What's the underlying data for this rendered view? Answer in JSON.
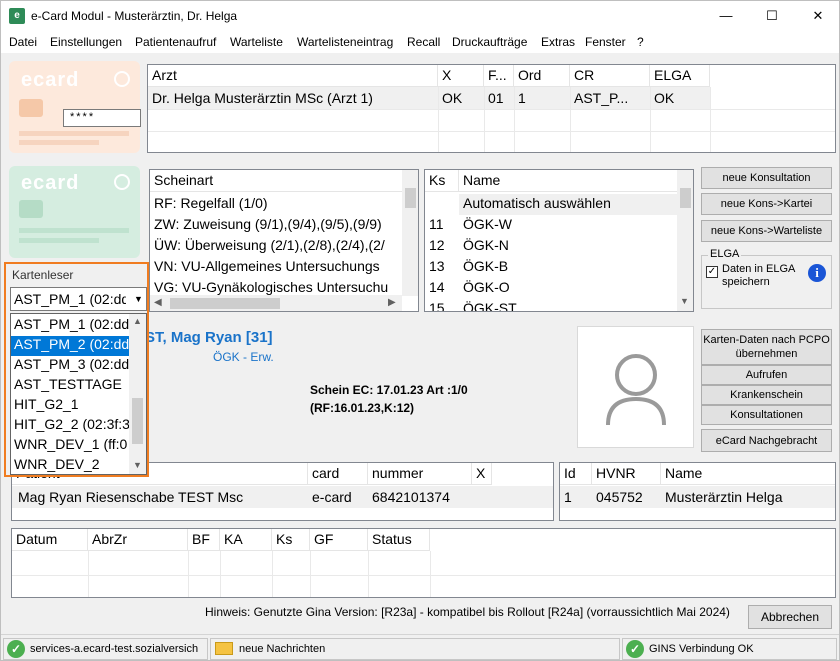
{
  "window": {
    "title": "e-Card Modul - Musterärztin, Dr. Helga",
    "minimize": "—",
    "maximize": "☐",
    "close": "✕"
  },
  "menu": [
    "Datei",
    "Einstellungen",
    "Patientenaufruf",
    "Warteliste",
    "Wartelisteneintrag",
    "Recall",
    "Druckaufträge",
    "Extras",
    "Fenster",
    "?"
  ],
  "ecard_top": {
    "logo": "ecard",
    "pin": "****"
  },
  "ecard_bottom": {
    "logo": "ecard"
  },
  "arzt_table": {
    "headers": [
      "Arzt",
      "X",
      "F...",
      "Ord",
      "CR",
      "ELGA"
    ],
    "rows": [
      [
        "Dr. Helga Musterärztin MSc (Arzt 1)",
        "OK",
        "01",
        "1",
        "AST_P...",
        "OK"
      ]
    ]
  },
  "scheinart": {
    "header": "Scheinart",
    "items": [
      "RF: Regelfall (1/0)",
      "ZW: Zuweisung (9/1),(9/4),(9/5),(9/9)",
      "ÜW: Überweisung (2/1),(2/8),(2/4),(2/",
      "VN: VU-Allgemeines Untersuchungs",
      "VG: VU-Gynäkologisches Untersuchu"
    ]
  },
  "ks_table": {
    "headers": [
      "Ks",
      "Name"
    ],
    "rows": [
      [
        "",
        "Automatisch auswählen"
      ],
      [
        "11",
        "ÖGK-W"
      ],
      [
        "12",
        "ÖGK-N"
      ],
      [
        "13",
        "ÖGK-B"
      ],
      [
        "14",
        "ÖGK-O"
      ],
      [
        "15",
        "ÖGK-ST"
      ]
    ]
  },
  "buttons_top": [
    "neue Konsultation",
    "neue Kons->Kartei",
    "neue Kons->Warteliste"
  ],
  "elga": {
    "group_label": "ELGA",
    "checkbox_label": "Daten in ELGA speichern",
    "checked": true,
    "info_icon": "i"
  },
  "kartenleser": {
    "label": "Kartenleser",
    "selected": "AST_PM_1 (02:dd",
    "options": [
      "AST_PM_1 (02:dd",
      "AST_PM_2 (02:dd",
      "AST_PM_3 (02:dd",
      "AST_TESTTAGE",
      "HIT_G2_1",
      "HIT_G2_2 (02:3f:3",
      "WNR_DEV_1 (ff:0",
      "WNR_DEV_2"
    ],
    "highlighted_index": 1
  },
  "patient": {
    "name_partial": "ST, Mag Ryan [31]",
    "kasse": "ÖGK - Erw.",
    "schein_line": "Schein EC: 17.01.23  Art :1/0",
    "rf_line": "(RF:16.01.23,K:12)"
  },
  "buttons_right": [
    "Karten-Daten nach PCPO übernehmen",
    "Aufrufen",
    "Krankenschein",
    "Konsultationen",
    "eCard Nachgebracht"
  ],
  "patient_table": {
    "headers": [
      "Patient",
      "card",
      "nummer",
      "X"
    ],
    "rows": [
      [
        "Mag Ryan Riesenschabe TEST Msc",
        "e-card",
        "6842101374",
        ""
      ]
    ]
  },
  "hv_table": {
    "headers": [
      "Id",
      "HVNR",
      "Name"
    ],
    "rows": [
      [
        "1",
        "045752",
        "Musterärztin Helga"
      ]
    ]
  },
  "kons_table": {
    "headers": [
      "Datum",
      "AbrZr",
      "BF",
      "KA",
      "Ks",
      "GF",
      "Status"
    ]
  },
  "hinweis": "Hinweis: Genutzte Gina Version: [R23a] - kompatibel bis Rollout [R24a] (vorraussichtlich Mai 2024)",
  "abbrechen": "Abbrechen",
  "status": {
    "server": "services-a.ecard-test.sozialversich",
    "messages": "neue Nachrichten",
    "gins": "GINS Verbindung OK"
  },
  "colors": {
    "accent": "#0078d7",
    "highlight_border": "#f07c20",
    "patient_blue": "#1a73c9"
  }
}
